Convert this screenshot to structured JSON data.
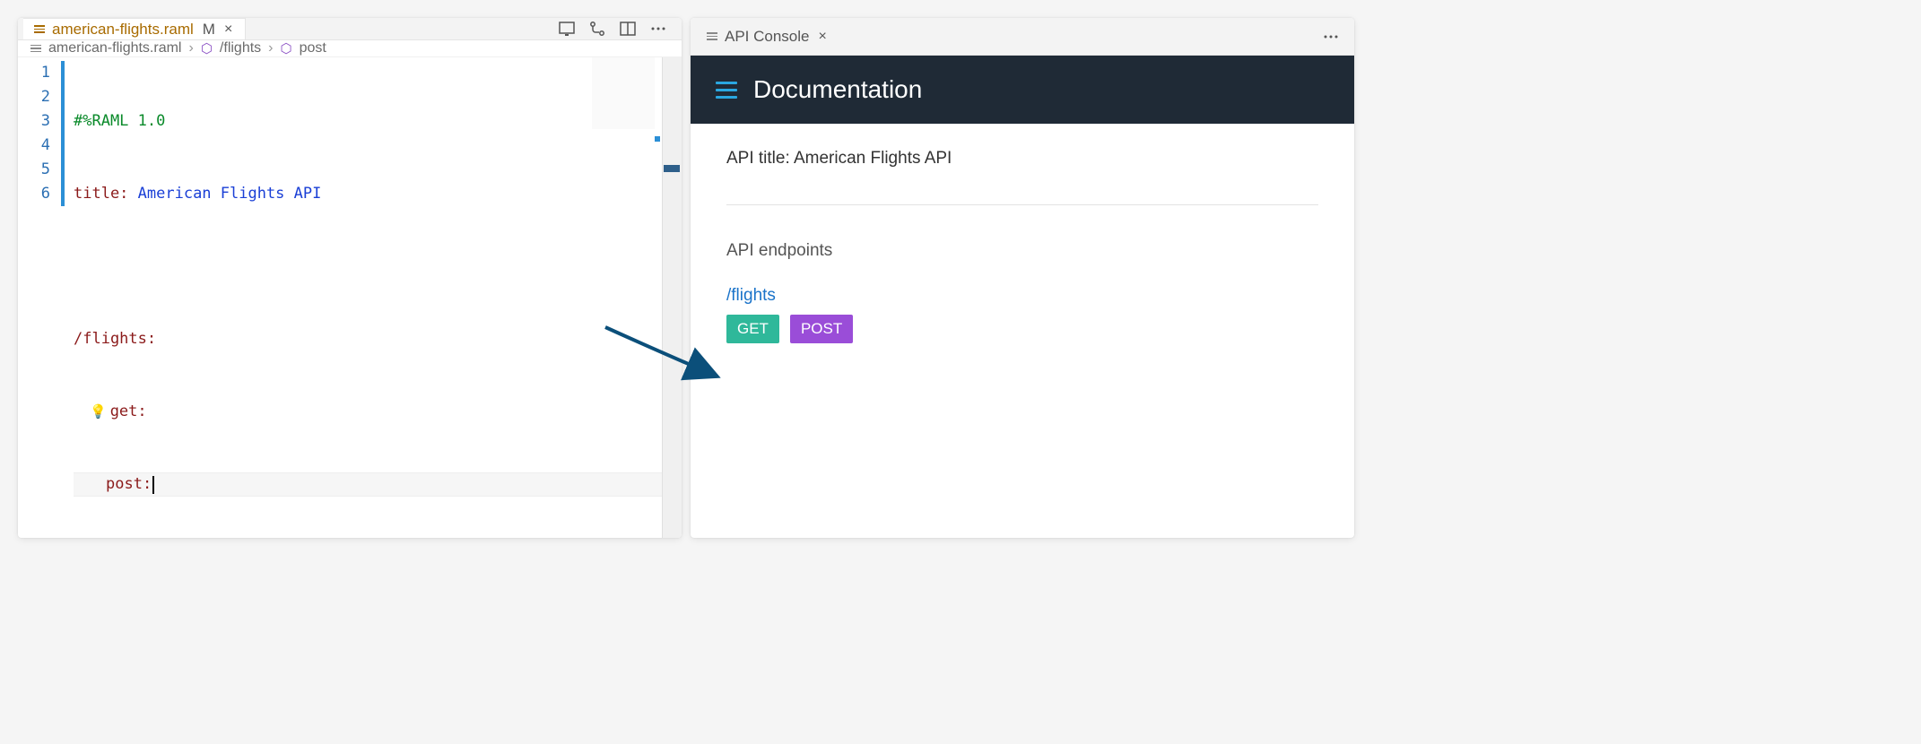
{
  "editor": {
    "tab": {
      "filename": "american-flights.raml",
      "dirty_marker": "M"
    },
    "breadcrumb": {
      "file": "american-flights.raml",
      "seg1": "/flights",
      "seg2": "post"
    },
    "gutter_lines": [
      "1",
      "2",
      "3",
      "4",
      "5",
      "6"
    ],
    "code": {
      "l1": "#%RAML 1.0",
      "l2_key": "title:",
      "l2_val": " American Flights API",
      "l4_key": "/flights:",
      "l5_key": "get:",
      "l6_key": "post:"
    }
  },
  "console": {
    "tab_title": "API Console",
    "header": "Documentation",
    "api_title_label": "API title: ",
    "api_title_value": "American Flights API",
    "endpoints_label": "API endpoints",
    "endpoint_path": "/flights",
    "methods": {
      "get": "GET",
      "post": "POST"
    }
  }
}
